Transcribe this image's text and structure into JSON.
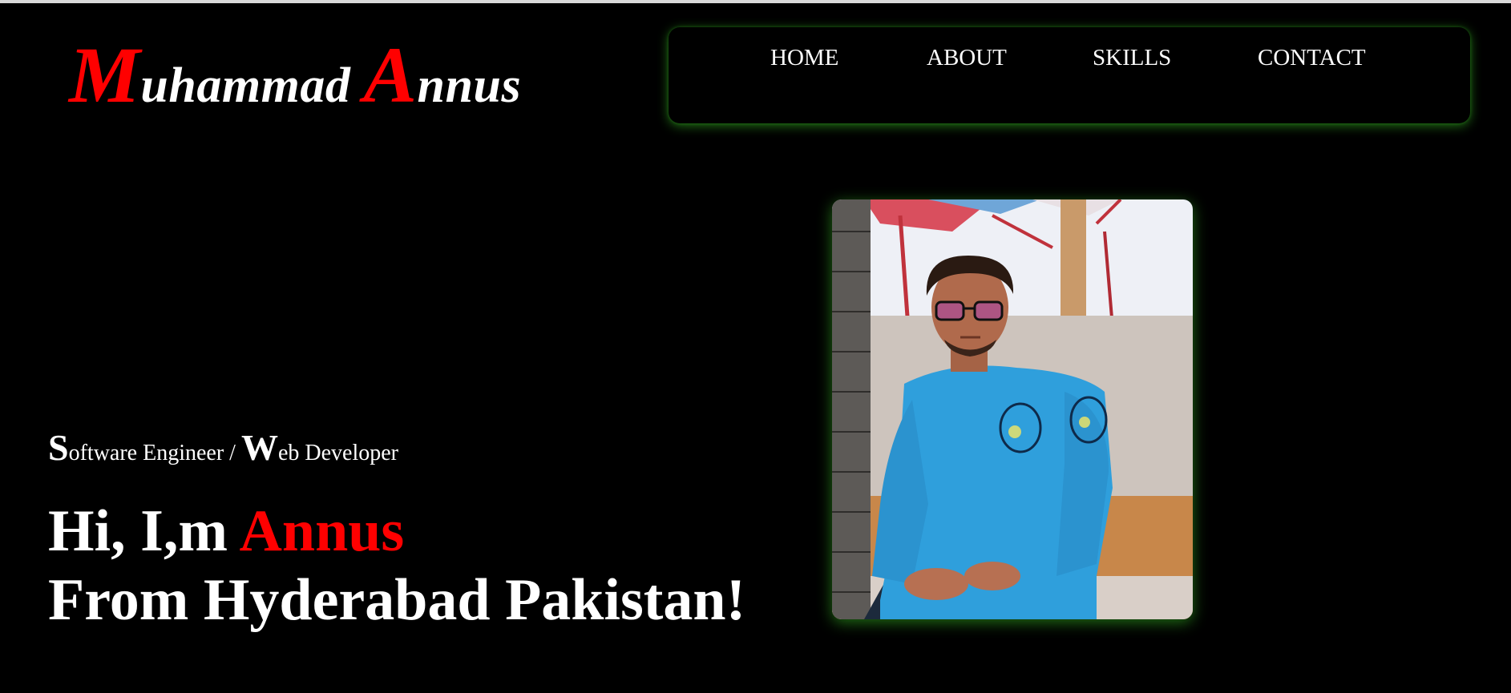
{
  "logo": {
    "first_initial": "M",
    "first_rest": "uhammad",
    "last_initial": "A",
    "last_rest": "nnus"
  },
  "nav": {
    "items": [
      "HOME",
      "ABOUT",
      "SKILLS",
      "CONTACT"
    ]
  },
  "hero": {
    "subtitle_s": "S",
    "subtitle_part1": "oftware Engineer / ",
    "subtitle_w": "W",
    "subtitle_part2": "eb Developer",
    "greeting": "Hi, I,m ",
    "name": "Annus",
    "location_line": "From Hyderabad Pakistan!"
  },
  "photo": {
    "alt": "Profile photo"
  },
  "colors": {
    "background": "#000000",
    "accent": "#ff0000",
    "text": "#ffffff",
    "glow": "#3cc828"
  }
}
